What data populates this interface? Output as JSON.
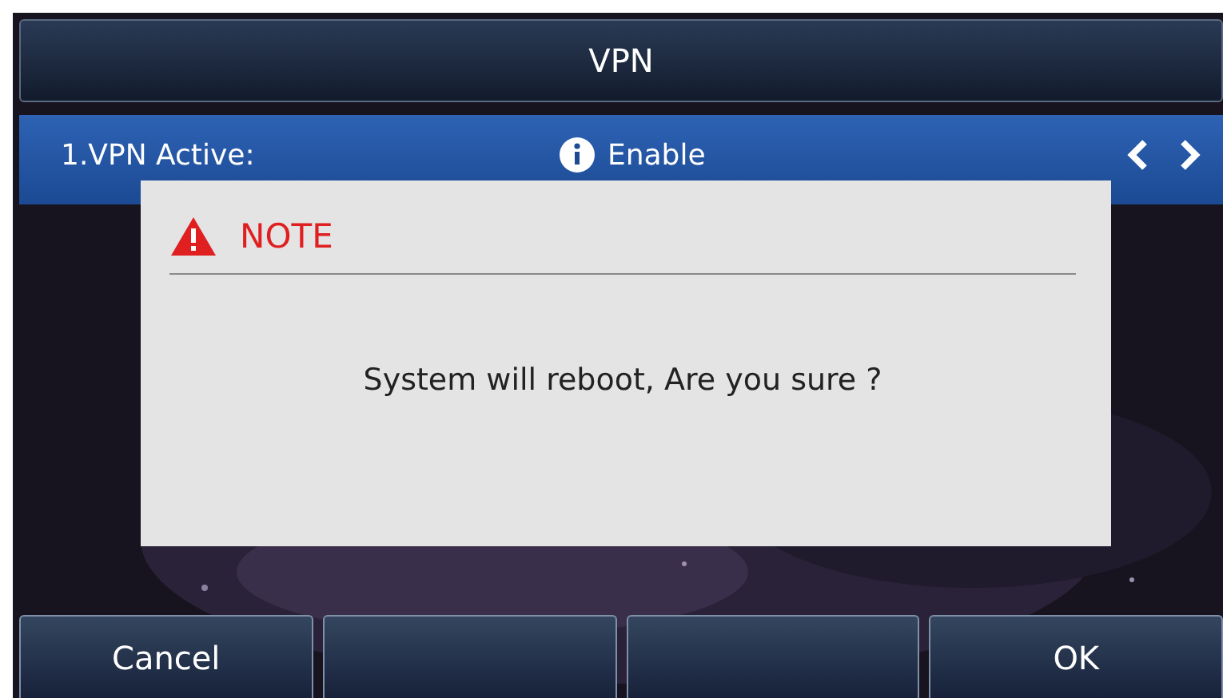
{
  "title": "VPN",
  "setting_row": {
    "label": "1.VPN Active:",
    "value": "Enable",
    "selected": true
  },
  "dialog": {
    "title": "NOTE",
    "message": "System will reboot, Are you sure ?"
  },
  "softkeys": [
    {
      "kind": "text",
      "label": "Cancel"
    },
    {
      "kind": "blank"
    },
    {
      "kind": "blank"
    },
    {
      "kind": "text",
      "label": "OK"
    }
  ]
}
